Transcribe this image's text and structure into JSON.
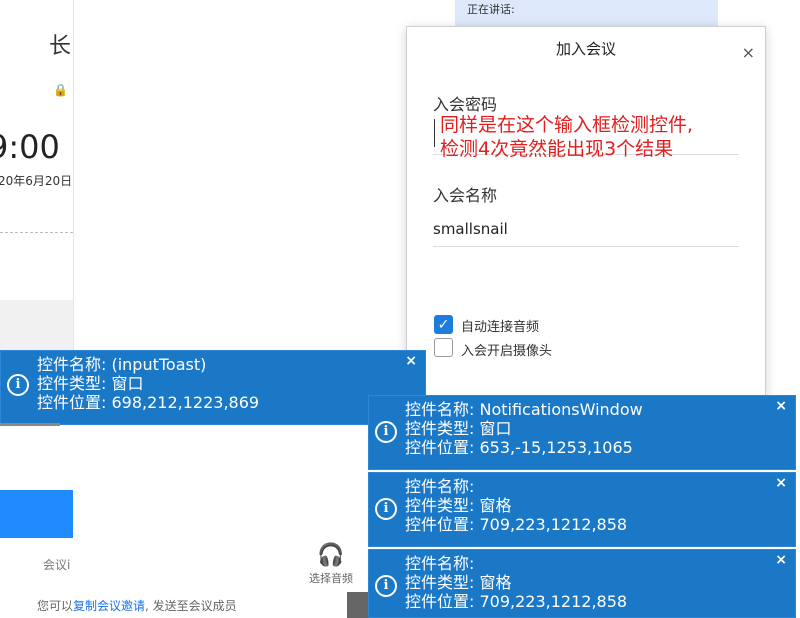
{
  "left_card": {
    "title_char": "长",
    "time": "9:00",
    "date": "20年6月20日"
  },
  "speaking_bar": {
    "label": "正在讲话:"
  },
  "dialog": {
    "title": "加入会议",
    "close": "×",
    "password_label": "入会密码",
    "password_value": "",
    "annotation_line1": "同样是在这个输入框检测控件,",
    "annotation_line2": "检测4次竟然能出现3个结果",
    "name_label": "入会名称",
    "name_value": "smallsnail",
    "checkbox_audio": {
      "label": "自动连接音频",
      "checked": true
    },
    "checkbox_camera": {
      "label": "入会开启摄像头",
      "checked": false
    }
  },
  "lower_panel": {
    "meeting_label": "会议i",
    "audio_label": "选择音频",
    "invite_prefix": "您可以",
    "invite_link": "复制会议邀请",
    "invite_suffix": ", 发送至会议成员"
  },
  "toasts": [
    {
      "name_line": "控件名称: (inputToast)",
      "type_line": "控件类型: 窗口",
      "pos_line": "控件位置: 698,212,1223,869",
      "close": "×"
    },
    {
      "name_line": "控件名称: NotificationsWindow",
      "type_line": "控件类型: 窗口",
      "pos_line": "控件位置: 653,-15,1253,1065",
      "close": "×"
    },
    {
      "name_line": "控件名称:",
      "type_line": "控件类型: 窗格",
      "pos_line": "控件位置: 709,223,1212,858",
      "close": "×"
    },
    {
      "name_line": "控件名称:",
      "type_line": "控件类型: 窗格",
      "pos_line": "控件位置: 709,223,1212,858",
      "close": "×"
    }
  ],
  "colors": {
    "toast_bg": "#1b78c7",
    "annotation_red": "#e02020",
    "accent_blue": "#1c7ddc",
    "link_blue": "#1a73e8"
  }
}
